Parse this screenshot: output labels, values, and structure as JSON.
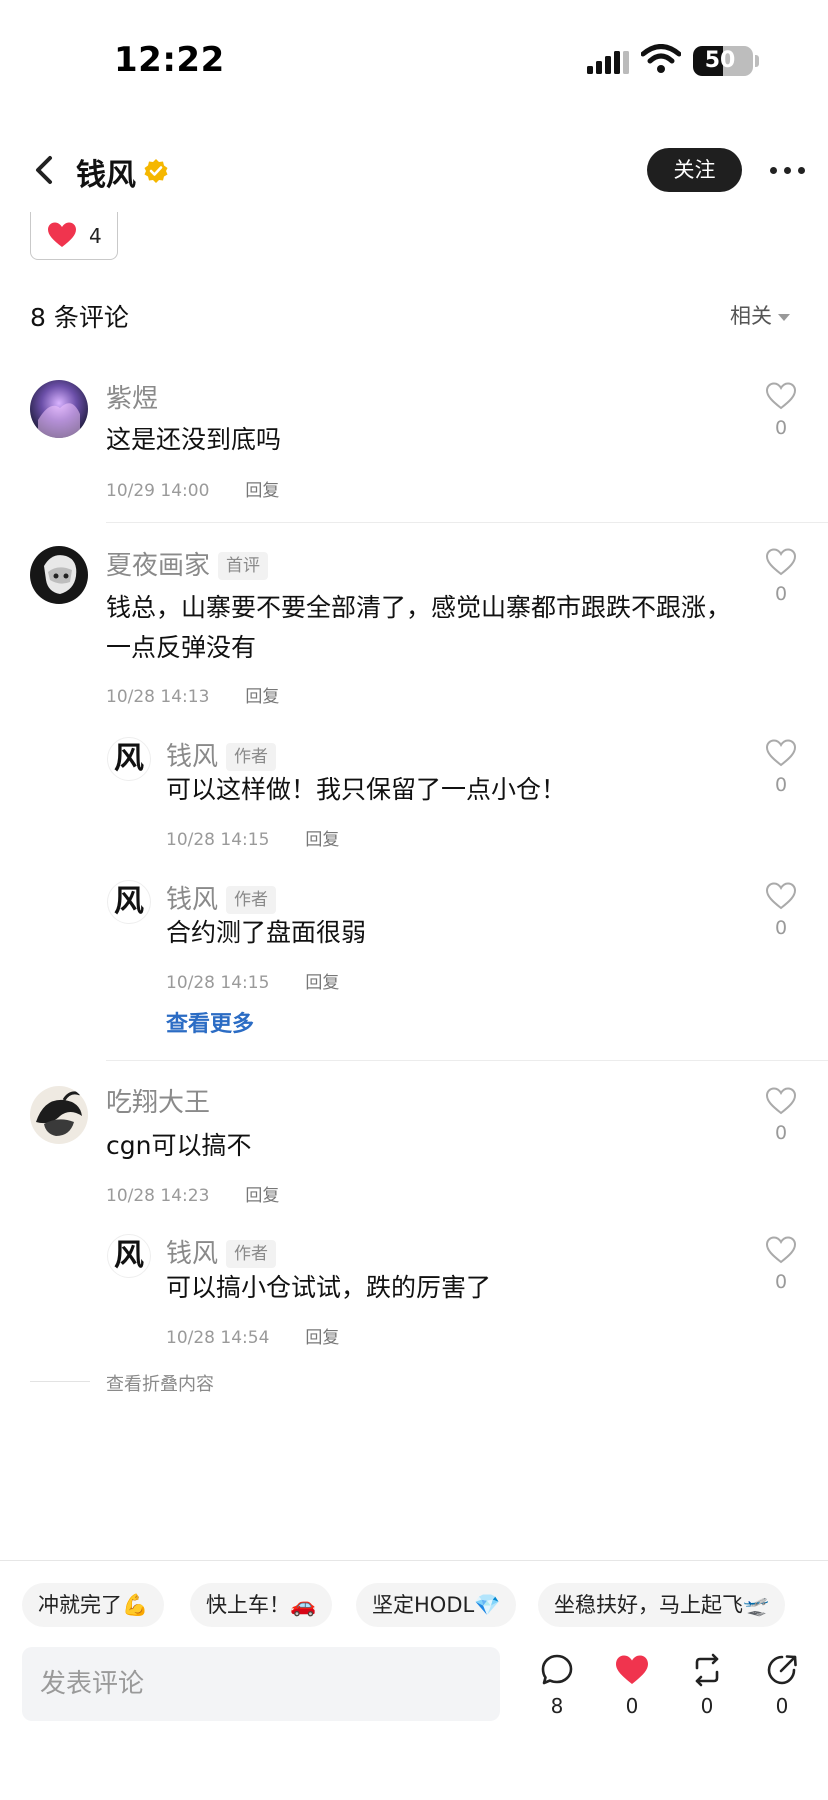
{
  "status_bar": {
    "time": "12:22",
    "battery": "50",
    "battery_level": 0.5
  },
  "header": {
    "author_name": "钱风",
    "follow_label": "关注"
  },
  "post_likes": {
    "count": "4"
  },
  "comments_section": {
    "count_label": "8 条评论",
    "sort_label": "相关"
  },
  "comments": [
    {
      "name": "紫煜",
      "badge": "",
      "text": "这是还没到底吗",
      "date": "10/29 14:00",
      "reply_label": "回复",
      "likes": "0"
    },
    {
      "name": "夏夜画家",
      "badge": "首评",
      "text": "钱总，山寨要不要全部清了，感觉山寨都市跟跌不跟涨，一点反弹没有",
      "date": "10/28 14:13",
      "reply_label": "回复",
      "likes": "0"
    },
    {
      "name": "吃翔大王",
      "badge": "",
      "text": "cgn可以搞不",
      "date": "10/28 14:23",
      "reply_label": "回复",
      "likes": "0"
    }
  ],
  "replies": [
    {
      "avatar_glyph": "风",
      "name": "钱风",
      "badge": "作者",
      "text": "可以这样做！我只保留了一点小仓！",
      "date": "10/28 14:15",
      "reply_label": "回复",
      "likes": "0"
    },
    {
      "avatar_glyph": "风",
      "name": "钱风",
      "badge": "作者",
      "text": "合约测了盘面很弱",
      "date": "10/28 14:15",
      "reply_label": "回复",
      "likes": "0"
    },
    {
      "avatar_glyph": "风",
      "name": "钱风",
      "badge": "作者",
      "text": "可以搞小仓试试，跌的厉害了",
      "date": "10/28 14:54",
      "reply_label": "回复",
      "likes": "0"
    }
  ],
  "view_more_label": "查看更多",
  "folded_label": "查看折叠内容",
  "quick_replies": [
    "冲就完了💪",
    "快上车！🚗",
    "坚定HODL💎",
    "坐稳扶好，马上起飞🛫"
  ],
  "composer": {
    "placeholder": "发表评论"
  },
  "actions": {
    "comments": "8",
    "likes": "0",
    "reposts": "0",
    "shares": "0"
  },
  "colors": {
    "like_red": "#f0344e",
    "link_blue": "#2b6cc4",
    "verified_gold": "#f5b700",
    "follow_bg": "#1f1f1f"
  }
}
